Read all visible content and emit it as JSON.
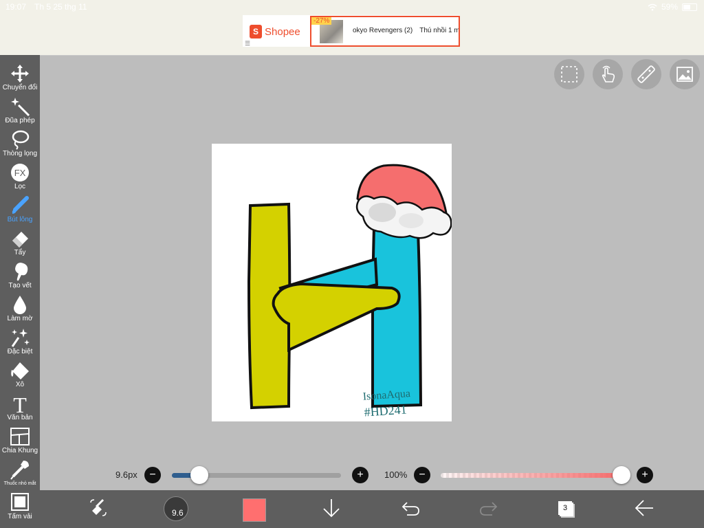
{
  "status_bar": {
    "time": "19:07",
    "date": "Th 5 25 thg 11",
    "battery": "59%"
  },
  "ad": {
    "brand": "Shopee",
    "brand_glyph": "S",
    "menu_glyph": "☰",
    "discount": "-27%",
    "product_1": "okyo Revengers (2)",
    "product_2": "Thú nhồi 1 m"
  },
  "toolbar": {
    "items": [
      {
        "label": "Chuyển đổi",
        "icon": "move-icon"
      },
      {
        "label": "Đũa phép",
        "icon": "magic-wand-icon"
      },
      {
        "label": "Thòng lọng",
        "icon": "lasso-icon"
      },
      {
        "label": "Lọc",
        "icon": "fx-filter-icon",
        "glyph": "FX"
      },
      {
        "label": "Bút lông",
        "icon": "brush-icon",
        "active": true
      },
      {
        "label": "Tẩy",
        "icon": "eraser-icon"
      },
      {
        "label": "Tạo vết",
        "icon": "smudge-icon"
      },
      {
        "label": "Làm mờ",
        "icon": "blur-icon"
      },
      {
        "label": "Đặc biệt",
        "icon": "special-icon"
      },
      {
        "label": "Xô",
        "icon": "bucket-icon"
      },
      {
        "label": "Văn bản",
        "icon": "text-icon",
        "glyph": "T"
      },
      {
        "label": "Chia Khung",
        "icon": "frame-divider-icon"
      },
      {
        "label": "Thuốc nhỏ mắt",
        "icon": "eyedropper-icon"
      },
      {
        "label": "Tấm vải",
        "icon": "canvas-icon"
      }
    ]
  },
  "top_right_buttons": [
    "selection-icon",
    "touch-gesture-icon",
    "ruler-icon",
    "image-icon"
  ],
  "brush_size": {
    "label": "9.6px",
    "value": 9.6,
    "fraction": 0.08
  },
  "opacity": {
    "label": "100%",
    "value": 100
  },
  "controls": {
    "minus": "−",
    "plus": "+"
  },
  "bottom_bar": {
    "brush_preview_label": "9.6",
    "color": "#ff6f6f",
    "layer_count": "3"
  },
  "artwork": {
    "signature_line1": "IsonaAqua",
    "signature_line2": "#HD241",
    "colors": {
      "yellow": "#d4d100",
      "cyan": "#19c3dc",
      "hat": "#f56e6e",
      "ink": "#111111",
      "signature": "#1f6c70"
    }
  },
  "colors": {
    "toolbar_bg": "#5e5e5e",
    "workspace_bg": "#bdbdbd",
    "active_tool": "#4aa3ff",
    "size_track": "#2f5e8e",
    "opacity_track": "#f46a6a"
  }
}
